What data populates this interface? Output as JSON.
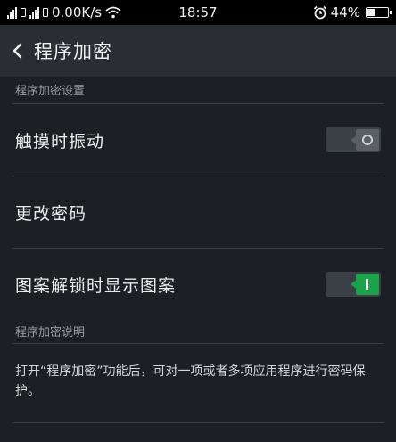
{
  "status_bar": {
    "network_speed": "0.00K/s",
    "time": "18:57",
    "battery_percent": "44%",
    "battery_level": 0.44,
    "icons": [
      "signal-icon",
      "sim-icon",
      "signal-icon",
      "sim-icon",
      "wifi-icon",
      "alarm-icon",
      "battery-icon"
    ]
  },
  "header": {
    "title": "程序加密",
    "back_icon": "chevron-left-icon"
  },
  "settings_section": {
    "label": "程序加密设置",
    "items": [
      {
        "label": "触摸时振动",
        "type": "toggle",
        "state": "off"
      },
      {
        "label": "更改密码",
        "type": "link"
      },
      {
        "label": "图案解锁时显示图案",
        "type": "toggle",
        "state": "on"
      }
    ]
  },
  "description_section": {
    "label": "程序加密说明",
    "text": "打开“程序加密”功能后，可对一项或者多项应用程序进行密码保护。"
  },
  "colors": {
    "background": "#1c1f24",
    "header": "#2a2d33",
    "toggle_on": "#1ba34a",
    "toggle_off": "#5a5e66"
  }
}
